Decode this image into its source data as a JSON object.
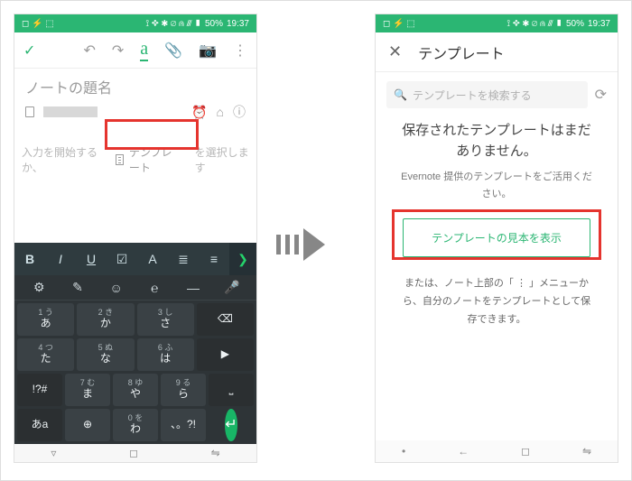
{
  "status": {
    "left_icons": "◻ ⚡ ⬚",
    "right_icons": "⟟ ✥ ✱ ⌀ ⋒ ⫻ ▮",
    "battery": "50%",
    "time": "19:37"
  },
  "editor": {
    "title_placeholder": "ノートの題名",
    "body_prefix": "入力を開始するか、",
    "template_chip": "テンプレート",
    "body_suffix": "を選択します"
  },
  "fmt": {
    "bold": "B",
    "italic": "I",
    "underline": "U",
    "check": "☑",
    "font": "A",
    "bullets": "≣",
    "numbers": "≡"
  },
  "kbd": {
    "tools": [
      "⚙",
      "✎",
      "☺",
      "℮",
      "—",
      "🎤"
    ],
    "rows": [
      [
        {
          "sub": "1",
          "sub2": "う",
          "main": "あ"
        },
        {
          "sub": "2",
          "sub2": "き",
          "main": "か"
        },
        {
          "sub": "3",
          "sub2": "し",
          "main": "さ"
        },
        {
          "main": "⌫",
          "dark": true
        }
      ],
      [
        {
          "sub": "4",
          "sub2": "つ",
          "main": "た"
        },
        {
          "sub": "5",
          "sub2": "ぬ",
          "main": "な"
        },
        {
          "sub": "6",
          "sub2": "ふ",
          "main": "は"
        },
        {
          "main": "▶",
          "dark": true
        }
      ],
      [
        {
          "main": "!?#",
          "dark": true
        },
        {
          "sub": "7",
          "sub2": "む",
          "main": "ま"
        },
        {
          "sub": "8",
          "sub2": "ゆ",
          "main": "や"
        },
        {
          "sub": "9",
          "sub2": "る",
          "main": "ら"
        },
        {
          "main": "⎵",
          "dark": true
        }
      ],
      [
        {
          "main": "あa",
          "dark": true
        },
        {
          "main": "⊕"
        },
        {
          "sub": "0",
          "sub2": "を",
          "main": "わ"
        },
        {
          "main": "、。?!"
        },
        {
          "go": true,
          "main": "↵"
        }
      ]
    ]
  },
  "nav": [
    "▿",
    "◻",
    "⇋"
  ],
  "right": {
    "title": "テンプレート",
    "search_placeholder": "テンプレートを検索する",
    "msg_title": "保存されたテンプレートはまだありません。",
    "msg_sub": "Evernote 提供のテンプレートをご活用ください。",
    "sample_btn": "テンプレートの見本を表示",
    "hint": "または、ノート上部の「 ⋮ 」メニューから、自分のノートをテンプレートとして保存できます。"
  },
  "nav2": [
    "•",
    "←",
    "◻",
    "⇋"
  ]
}
